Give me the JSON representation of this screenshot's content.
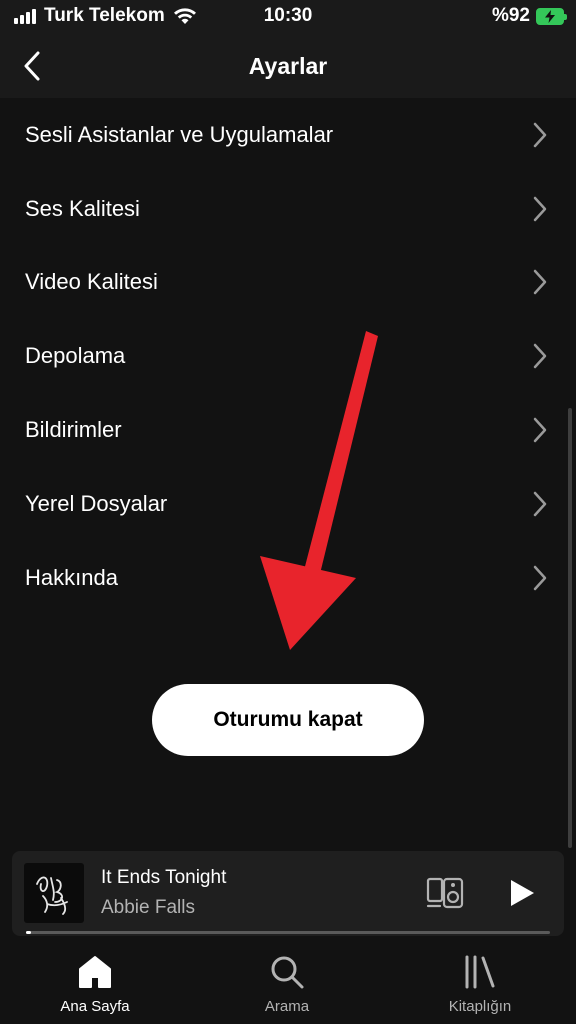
{
  "status_bar": {
    "carrier": "Turk Telekom",
    "time": "10:30",
    "battery": "%92"
  },
  "header": {
    "title": "Ayarlar"
  },
  "settings": {
    "items": [
      {
        "label": "Sesli Asistanlar ve Uygulamalar"
      },
      {
        "label": "Ses Kalitesi"
      },
      {
        "label": "Video Kalitesi"
      },
      {
        "label": "Depolama"
      },
      {
        "label": "Bildirimler"
      },
      {
        "label": "Yerel Dosyalar"
      },
      {
        "label": "Hakkında"
      }
    ]
  },
  "logout": {
    "label": "Oturumu kapat"
  },
  "player": {
    "title": "It Ends Tonight",
    "artist": "Abbie Falls",
    "progress": 0.01
  },
  "nav": {
    "home": "Ana Sayfa",
    "search": "Arama",
    "library": "Kitaplığın"
  },
  "colors": {
    "background": "#121212",
    "arrow": "#e8242c",
    "battery": "#34c759"
  },
  "icons": {
    "back": "chevron-left-icon",
    "row": "chevron-right-icon",
    "device": "connect-device-icon",
    "play": "play-icon",
    "home": "home-icon",
    "search": "search-icon",
    "library": "library-icon"
  }
}
